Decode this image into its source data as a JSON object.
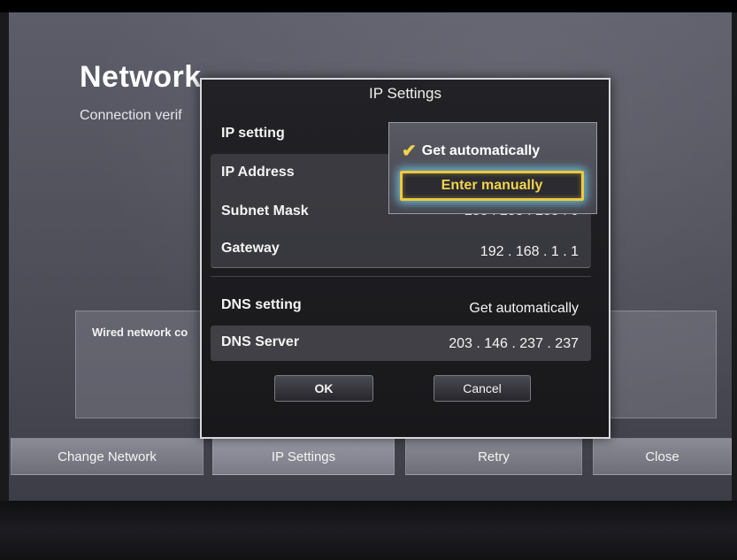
{
  "background_screen": {
    "title": "Network",
    "subtitle": "Connection verif",
    "info_text": "Wired network co",
    "bottom_buttons": [
      "Change Network",
      "IP Settings",
      "Retry",
      "Close"
    ]
  },
  "dialog": {
    "title": "IP Settings",
    "ip_setting_label": "IP setting",
    "ip_address_label": "IP Address",
    "subnet_mask_label": "Subnet Mask",
    "subnet_mask_value": "255 . 255 . 255 . 0",
    "gateway_label": "Gateway",
    "gateway_value": "192 . 168 . 1 . 1",
    "dns_setting_label": "DNS setting",
    "dns_setting_value": "Get automatically",
    "dns_server_label": "DNS Server",
    "dns_server_value": "203 . 146 . 237 . 237",
    "ok_label": "OK",
    "cancel_label": "Cancel"
  },
  "dropdown": {
    "options": [
      {
        "label": "Get automatically",
        "selected": true
      },
      {
        "label": "Enter manually",
        "focused": true
      }
    ],
    "check_icon": "checkmark-icon"
  },
  "colors": {
    "focus_border": "#f0c93a",
    "focus_glow": "#78dcff",
    "check": "#f3d34a"
  }
}
